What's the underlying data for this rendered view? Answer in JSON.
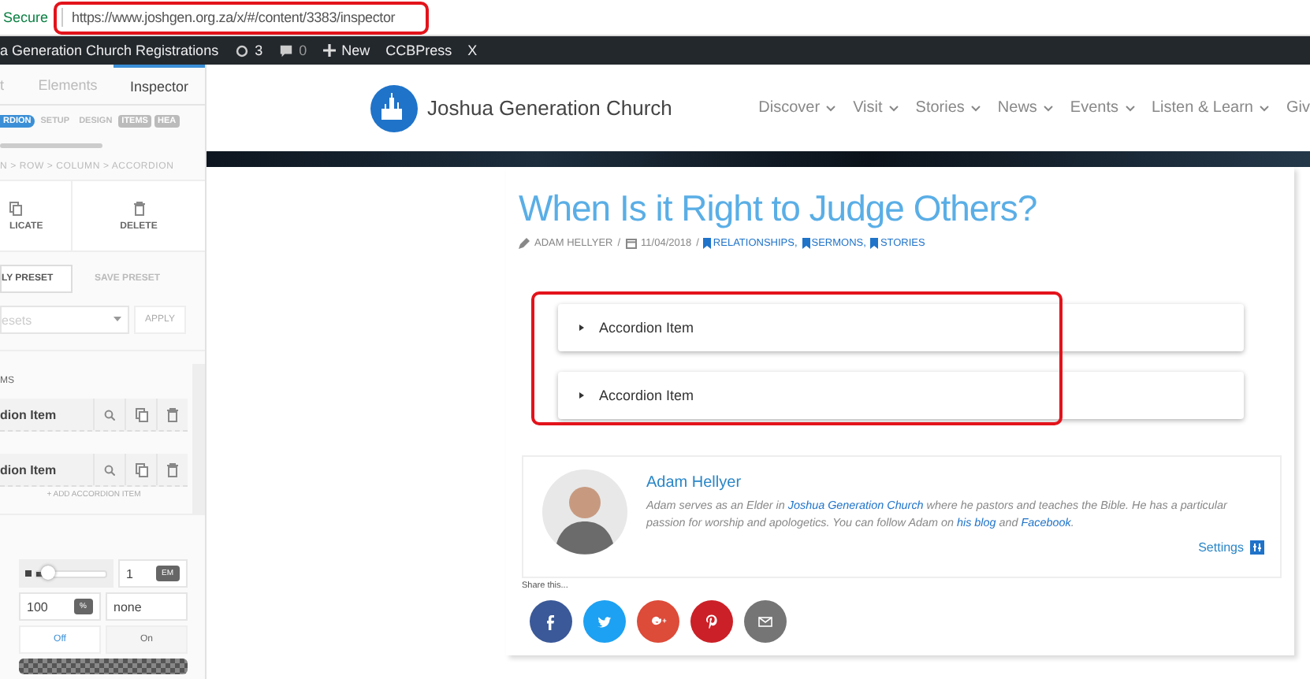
{
  "browser": {
    "security": "Secure",
    "url": "https://www.joshgen.org.za/x/#/content/3383/inspector"
  },
  "admin_bar": {
    "site": "a Generation Church Registrations",
    "updates": "3",
    "comments": "0",
    "new": "New",
    "items": [
      "CCBPress",
      "X"
    ]
  },
  "panel": {
    "tabs": [
      {
        "label": "t",
        "selected": false
      },
      {
        "label": "Elements",
        "selected": false
      },
      {
        "label": "Inspector",
        "selected": true
      }
    ],
    "sections": [
      {
        "label": "RDION",
        "kind": "current"
      },
      {
        "label": "SETUP",
        "kind": "link"
      },
      {
        "label": "DESIGN",
        "kind": "link"
      },
      {
        "label": "ITEMS",
        "kind": "tag"
      },
      {
        "label": "HEA",
        "kind": "tag"
      }
    ],
    "breadcrumb": "N > ROW > COLUMN > ACCORDION",
    "actions": [
      {
        "label": "LICATE",
        "kind": "duplicate"
      },
      {
        "label": "DELETE",
        "kind": "delete"
      }
    ],
    "preset_buttons": [
      "LY PRESET",
      "SAVE PRESET"
    ],
    "preset_select": {
      "placeholder": "esets"
    },
    "apply": "APPLY",
    "items_label": "MS",
    "items": [
      "dion Item",
      "dion Item"
    ],
    "add_item": "+ ADD ACCORDION ITEM",
    "slider": {
      "level": 0.15,
      "value": "1",
      "unit": "EM"
    },
    "size": {
      "value": "100",
      "unit": "%"
    },
    "style_value": "none",
    "toggle": [
      {
        "label": "Off",
        "selected": true
      },
      {
        "label": "On",
        "selected": false
      }
    ]
  },
  "site": {
    "logo": "Joshua Generation Church",
    "nav": [
      {
        "label": "Discover",
        "has_menu": true
      },
      {
        "label": "Visit",
        "has_menu": true
      },
      {
        "label": "Stories",
        "has_menu": true
      },
      {
        "label": "News",
        "has_menu": true
      },
      {
        "label": "Events",
        "has_menu": true
      },
      {
        "label": "Listen & Learn",
        "has_menu": true
      },
      {
        "label": "Giv",
        "has_menu": false
      }
    ]
  },
  "post": {
    "title": "When Is it Right to Judge Others?",
    "author": "ADAM HELLYER",
    "separator": "/",
    "date": "11/04/2018",
    "categories": [
      "RELATIONSHIPS,",
      "SERMONS,",
      "STORIES"
    ],
    "accordion": [
      {
        "label": "Accordion Item",
        "expanded": false
      },
      {
        "label": "Accordion Item",
        "expanded": false
      }
    ],
    "author_box": {
      "name": "Adam Hellyer",
      "bio": [
        {
          "kind": "text",
          "text": "Adam serves as an Elder in "
        },
        {
          "kind": "link",
          "text": "Joshua Generation Church"
        },
        {
          "kind": "text",
          "text": " where he pastors and teaches the Bible. He has a particular passion for worship and apologetics. You can follow Adam on "
        },
        {
          "kind": "link",
          "text": "his blog"
        },
        {
          "kind": "text",
          "text": " and "
        },
        {
          "kind": "link",
          "text": "Facebook"
        },
        {
          "kind": "text",
          "text": "."
        }
      ],
      "settings": "Settings"
    },
    "share_label": "Share this...",
    "share": [
      {
        "kind": "facebook",
        "color": "#3b5998"
      },
      {
        "kind": "twitter",
        "color": "#1da1f2"
      },
      {
        "kind": "googleplus",
        "color": "#dd4b39"
      },
      {
        "kind": "pinterest",
        "color": "#cb2027"
      },
      {
        "kind": "email",
        "color": "#757575"
      }
    ]
  }
}
